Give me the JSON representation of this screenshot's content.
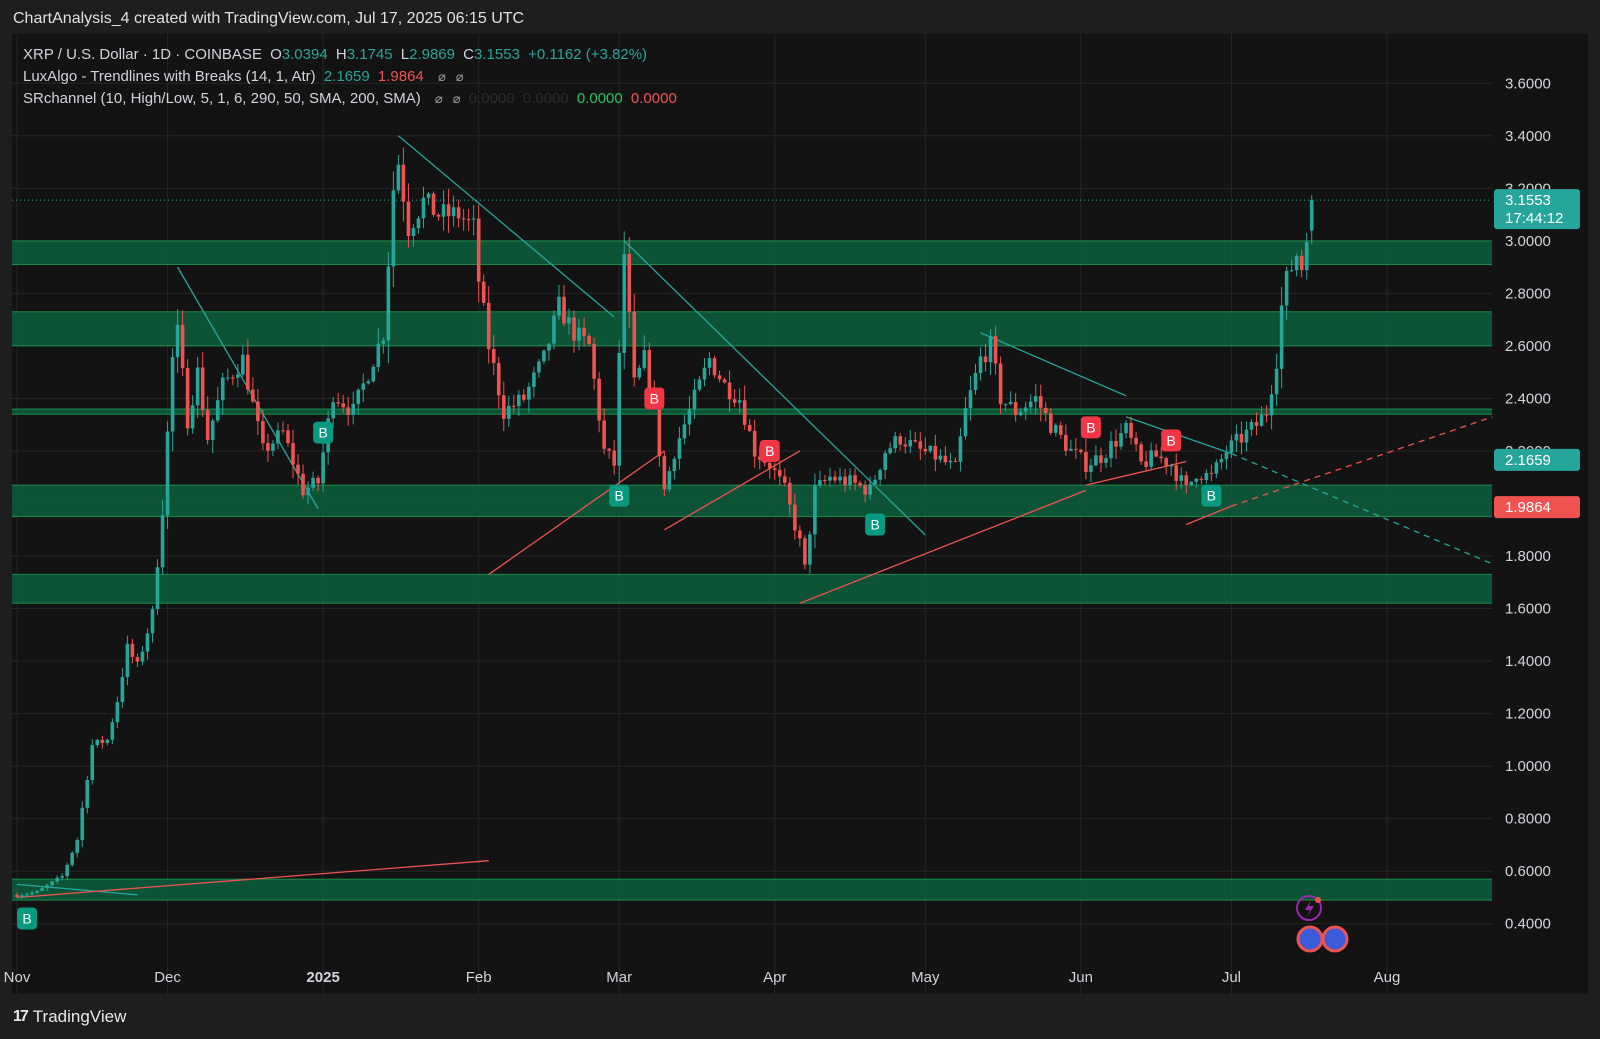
{
  "header": {
    "title": "ChartAnalysis_4 created with TradingView.com, Jul 17, 2025 06:15 UTC"
  },
  "legend": {
    "symbol": "XRP / U.S. Dollar · 1D · COINBASE",
    "o_label": "O",
    "o": "3.0394",
    "h_label": "H",
    "h": "3.1745",
    "l_label": "L",
    "l": "2.9869",
    "c_label": "C",
    "c": "3.1553",
    "change": "+0.1162 (+3.82%)",
    "ind1_name": "LuxAlgo - Trendlines with Breaks (14, 1, Atr)",
    "ind1_v1": "2.1659",
    "ind1_v2": "1.9864",
    "ind2_name": "SRchannel (10, High/Low, 5, 1, 6, 290, 50, SMA, 200, SMA)",
    "ind2_v1": "0.0000",
    "ind2_v2": "0.0000",
    "ind2_v3": "0.0000",
    "ind2_v4": "0.0000"
  },
  "footer": {
    "brand": "TradingView"
  },
  "colors": {
    "up": "#26a69a",
    "down": "#ef5350",
    "zone": "#0d5f3d",
    "zoneEdge": "#22c55e",
    "bg": "#141414"
  },
  "chart_data": {
    "type": "candlestick",
    "ylim": [
      0.3,
      3.7
    ],
    "y_ticks": [
      "3.6000",
      "3.4000",
      "3.2000",
      "3.0000",
      "2.8000",
      "2.6000",
      "2.4000",
      "2.2000",
      "2.0000",
      "1.8000",
      "1.6000",
      "1.4000",
      "1.2000",
      "1.0000",
      "0.8000",
      "0.6000",
      "0.4000"
    ],
    "x_ticks": [
      {
        "label": "Nov",
        "date": "2024-11-01"
      },
      {
        "label": "Dec",
        "date": "2024-12-01"
      },
      {
        "label": "2025",
        "date": "2025-01-01"
      },
      {
        "label": "Feb",
        "date": "2025-02-01"
      },
      {
        "label": "Mar",
        "date": "2025-03-01"
      },
      {
        "label": "Apr",
        "date": "2025-04-01"
      },
      {
        "label": "May",
        "date": "2025-05-01"
      },
      {
        "label": "Jun",
        "date": "2025-06-01"
      },
      {
        "label": "Jul",
        "date": "2025-07-01"
      },
      {
        "label": "Aug",
        "date": "2025-08-01"
      }
    ],
    "last_price": {
      "value": 3.1553,
      "label": "3.1553",
      "countdown": "17:44:12"
    },
    "price_labels": [
      {
        "value": 2.1659,
        "label": "2.1659",
        "color": "#26a69a"
      },
      {
        "value": 1.9864,
        "label": "1.9864",
        "color": "#ef5350"
      }
    ],
    "sr_zones": [
      [
        2.91,
        3.0
      ],
      [
        2.6,
        2.73
      ],
      [
        2.34,
        2.36
      ],
      [
        1.95,
        2.07
      ],
      [
        1.62,
        1.73
      ],
      [
        0.49,
        0.57
      ]
    ],
    "anchors": [
      {
        "date": "2024-11-01",
        "close": 0.51
      },
      {
        "date": "2024-11-05",
        "close": 0.52
      },
      {
        "date": "2024-11-10",
        "close": 0.58
      },
      {
        "date": "2024-11-13",
        "close": 0.72
      },
      {
        "date": "2024-11-16",
        "close": 1.08
      },
      {
        "date": "2024-11-19",
        "close": 1.1
      },
      {
        "date": "2024-11-21",
        "close": 1.25
      },
      {
        "date": "2024-11-23",
        "close": 1.45
      },
      {
        "date": "2024-11-25",
        "close": 1.38
      },
      {
        "date": "2024-11-28",
        "close": 1.58
      },
      {
        "date": "2024-11-30",
        "close": 1.98
      },
      {
        "date": "2024-12-02",
        "close": 2.55
      },
      {
        "date": "2024-12-03",
        "close": 2.65
      },
      {
        "date": "2024-12-05",
        "close": 2.32
      },
      {
        "date": "2024-12-07",
        "close": 2.5
      },
      {
        "date": "2024-12-09",
        "close": 2.25
      },
      {
        "date": "2024-12-12",
        "close": 2.45
      },
      {
        "date": "2024-12-16",
        "close": 2.55
      },
      {
        "date": "2024-12-20",
        "close": 2.2
      },
      {
        "date": "2024-12-24",
        "close": 2.27
      },
      {
        "date": "2024-12-28",
        "close": 2.05
      },
      {
        "date": "2024-12-31",
        "close": 2.08
      },
      {
        "date": "2025-01-03",
        "close": 2.42
      },
      {
        "date": "2025-01-07",
        "close": 2.35
      },
      {
        "date": "2025-01-10",
        "close": 2.5
      },
      {
        "date": "2025-01-13",
        "close": 2.65
      },
      {
        "date": "2025-01-15",
        "close": 3.2
      },
      {
        "date": "2025-01-16",
        "close": 3.3
      },
      {
        "date": "2025-01-18",
        "close": 3.05
      },
      {
        "date": "2025-01-21",
        "close": 3.15
      },
      {
        "date": "2025-01-24",
        "close": 3.1
      },
      {
        "date": "2025-01-28",
        "close": 3.1
      },
      {
        "date": "2025-01-31",
        "close": 3.05
      },
      {
        "date": "2025-02-01",
        "close": 2.85
      },
      {
        "date": "2025-02-03",
        "close": 2.6
      },
      {
        "date": "2025-02-06",
        "close": 2.35
      },
      {
        "date": "2025-02-10",
        "close": 2.4
      },
      {
        "date": "2025-02-14",
        "close": 2.55
      },
      {
        "date": "2025-02-17",
        "close": 2.75
      },
      {
        "date": "2025-02-20",
        "close": 2.65
      },
      {
        "date": "2025-02-23",
        "close": 2.6
      },
      {
        "date": "2025-02-26",
        "close": 2.2
      },
      {
        "date": "2025-02-28",
        "close": 2.15
      },
      {
        "date": "2025-03-02",
        "close": 2.95
      },
      {
        "date": "2025-03-04",
        "close": 2.45
      },
      {
        "date": "2025-03-06",
        "close": 2.55
      },
      {
        "date": "2025-03-08",
        "close": 2.35
      },
      {
        "date": "2025-03-10",
        "close": 2.05
      },
      {
        "date": "2025-03-12",
        "close": 2.2
      },
      {
        "date": "2025-03-15",
        "close": 2.35
      },
      {
        "date": "2025-03-19",
        "close": 2.55
      },
      {
        "date": "2025-03-22",
        "close": 2.45
      },
      {
        "date": "2025-03-25",
        "close": 2.4
      },
      {
        "date": "2025-03-28",
        "close": 2.2
      },
      {
        "date": "2025-03-31",
        "close": 2.15
      },
      {
        "date": "2025-04-03",
        "close": 2.05
      },
      {
        "date": "2025-04-06",
        "close": 1.85
      },
      {
        "date": "2025-04-07",
        "close": 1.75
      },
      {
        "date": "2025-04-09",
        "close": 2.05
      },
      {
        "date": "2025-04-12",
        "close": 2.1
      },
      {
        "date": "2025-04-16",
        "close": 2.08
      },
      {
        "date": "2025-04-20",
        "close": 2.05
      },
      {
        "date": "2025-04-23",
        "close": 2.2
      },
      {
        "date": "2025-04-26",
        "close": 2.25
      },
      {
        "date": "2025-04-30",
        "close": 2.2
      },
      {
        "date": "2025-05-03",
        "close": 2.18
      },
      {
        "date": "2025-05-07",
        "close": 2.13
      },
      {
        "date": "2025-05-09",
        "close": 2.35
      },
      {
        "date": "2025-05-12",
        "close": 2.55
      },
      {
        "date": "2025-05-14",
        "close": 2.6
      },
      {
        "date": "2025-05-16",
        "close": 2.4
      },
      {
        "date": "2025-05-19",
        "close": 2.35
      },
      {
        "date": "2025-05-23",
        "close": 2.4
      },
      {
        "date": "2025-05-26",
        "close": 2.3
      },
      {
        "date": "2025-05-30",
        "close": 2.2
      },
      {
        "date": "2025-06-02",
        "close": 2.15
      },
      {
        "date": "2025-06-05",
        "close": 2.18
      },
      {
        "date": "2025-06-07",
        "close": 2.22
      },
      {
        "date": "2025-06-10",
        "close": 2.28
      },
      {
        "date": "2025-06-13",
        "close": 2.15
      },
      {
        "date": "2025-06-16",
        "close": 2.18
      },
      {
        "date": "2025-06-19",
        "close": 2.15
      },
      {
        "date": "2025-06-22",
        "close": 2.05
      },
      {
        "date": "2025-06-24",
        "close": 2.12
      },
      {
        "date": "2025-06-27",
        "close": 2.1
      },
      {
        "date": "2025-06-30",
        "close": 2.2
      },
      {
        "date": "2025-07-03",
        "close": 2.25
      },
      {
        "date": "2025-07-06",
        "close": 2.3
      },
      {
        "date": "2025-07-08",
        "close": 2.35
      },
      {
        "date": "2025-07-10",
        "close": 2.55
      },
      {
        "date": "2025-07-11",
        "close": 2.75
      },
      {
        "date": "2025-07-12",
        "close": 2.85
      },
      {
        "date": "2025-07-13",
        "close": 2.9
      },
      {
        "date": "2025-07-14",
        "close": 2.95
      },
      {
        "date": "2025-07-15",
        "close": 2.9
      },
      {
        "date": "2025-07-16",
        "close": 3.04
      },
      {
        "date": "2025-07-17",
        "close": 3.1553
      }
    ],
    "trendlines": [
      {
        "from": [
          "2024-12-03",
          2.9
        ],
        "to": [
          "2024-12-31",
          1.98
        ],
        "color": "#26a69a",
        "dashed": false
      },
      {
        "from": [
          "2025-01-16",
          3.4
        ],
        "to": [
          "2025-02-28",
          2.71
        ],
        "color": "#26a69a",
        "dashed": false
      },
      {
        "from": [
          "2025-03-02",
          3.0
        ],
        "to": [
          "2025-05-01",
          1.88
        ],
        "color": "#26a69a",
        "dashed": false
      },
      {
        "from": [
          "2025-05-12",
          2.65
        ],
        "to": [
          "2025-06-10",
          2.41
        ],
        "color": "#26a69a",
        "dashed": false
      },
      {
        "from": [
          "2025-06-10",
          2.33
        ],
        "to": [
          "2025-07-01",
          2.19
        ],
        "color": "#26a69a",
        "dashed": false
      },
      {
        "from": [
          "2025-07-01",
          2.19
        ],
        "to": [
          "2025-08-22",
          1.77
        ],
        "color": "#26a69a",
        "dashed": true
      },
      {
        "from": [
          "2024-11-01",
          0.55
        ],
        "to": [
          "2024-11-25",
          0.51
        ],
        "color": "#26a69a",
        "dashed": false
      },
      {
        "from": [
          "2025-02-03",
          1.73
        ],
        "to": [
          "2025-03-10",
          2.2
        ],
        "color": "#ef5350",
        "dashed": false
      },
      {
        "from": [
          "2025-03-10",
          1.9
        ],
        "to": [
          "2025-04-06",
          2.2
        ],
        "color": "#ef5350",
        "dashed": false
      },
      {
        "from": [
          "2025-04-06",
          1.62
        ],
        "to": [
          "2025-06-02",
          2.05
        ],
        "color": "#ef5350",
        "dashed": false
      },
      {
        "from": [
          "2025-06-02",
          2.07
        ],
        "to": [
          "2025-06-22",
          2.16
        ],
        "color": "#ef5350",
        "dashed": false
      },
      {
        "from": [
          "2025-06-22",
          1.92
        ],
        "to": [
          "2025-07-01",
          1.99
        ],
        "color": "#ef5350",
        "dashed": false
      },
      {
        "from": [
          "2025-07-01",
          1.99
        ],
        "to": [
          "2025-08-22",
          2.33
        ],
        "color": "#ef5350",
        "dashed": true
      },
      {
        "from": [
          "2024-11-01",
          0.5
        ],
        "to": [
          "2025-02-03",
          0.64
        ],
        "color": "#ef5350",
        "dashed": false
      }
    ],
    "markers": [
      {
        "date": "2024-11-03",
        "value": 0.42,
        "label": "B",
        "color": "#089981"
      },
      {
        "date": "2025-01-01",
        "value": 2.27,
        "label": "B",
        "color": "#089981"
      },
      {
        "date": "2025-03-01",
        "value": 2.03,
        "label": "B",
        "color": "#089981"
      },
      {
        "date": "2025-03-08",
        "value": 2.4,
        "label": "B",
        "color": "#f23645"
      },
      {
        "date": "2025-03-31",
        "value": 2.2,
        "label": "B",
        "color": "#f23645"
      },
      {
        "date": "2025-04-21",
        "value": 1.92,
        "label": "B",
        "color": "#089981"
      },
      {
        "date": "2025-06-03",
        "value": 2.29,
        "label": "B",
        "color": "#f23645"
      },
      {
        "date": "2025-06-19",
        "value": 2.24,
        "label": "B",
        "color": "#f23645"
      },
      {
        "date": "2025-06-27",
        "value": 2.03,
        "label": "B",
        "color": "#089981"
      }
    ]
  }
}
